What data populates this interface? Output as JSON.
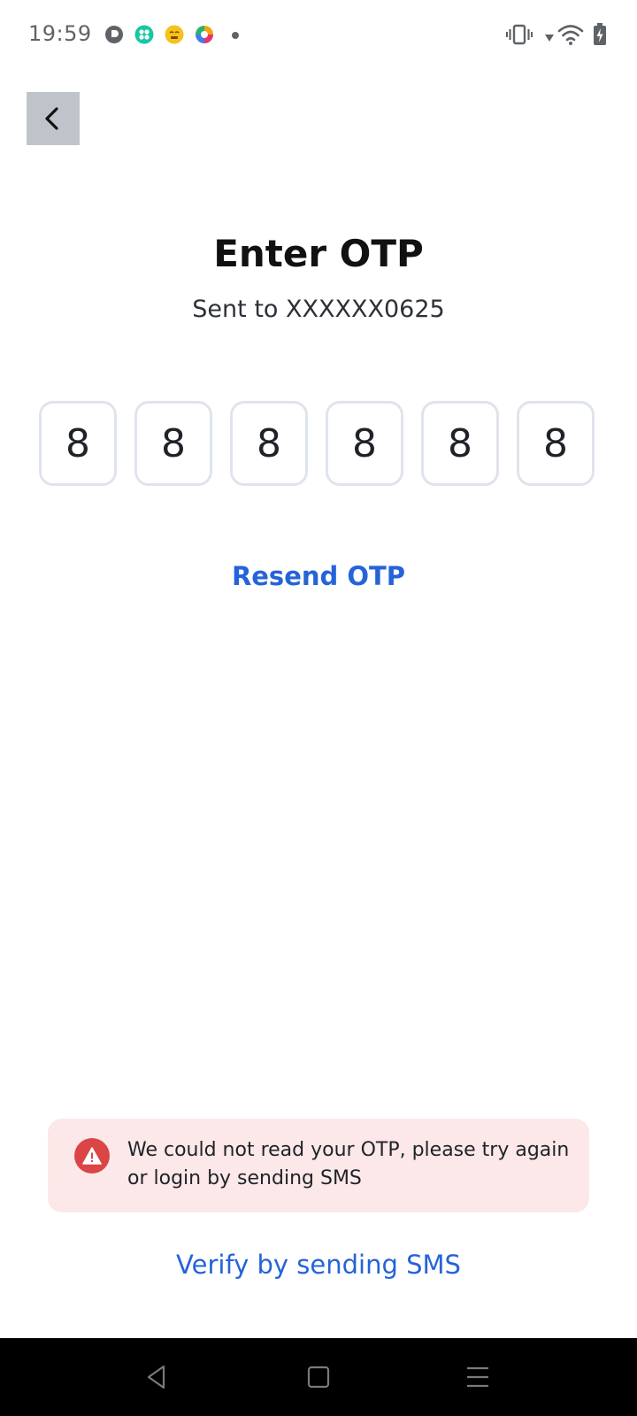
{
  "status_bar": {
    "time": "19:59",
    "notification_icons": [
      "podcast-app-icon",
      "grid-app-icon",
      "emoji-app-icon",
      "photos-app-icon",
      "more-dot-icon"
    ],
    "system_icons": [
      "vibrate-icon",
      "signal-arrow-icon",
      "wifi-icon",
      "battery-charging-icon"
    ]
  },
  "back_button": {
    "icon": "chevron-left-icon"
  },
  "title": "Enter OTP",
  "subtitle": "Sent to XXXXXX0625",
  "otp": {
    "digits": [
      "8",
      "8",
      "8",
      "8",
      "8",
      "8"
    ]
  },
  "resend_label": "Resend OTP",
  "error": {
    "icon": "warning-icon",
    "message": "We could not read your OTP, please try again or login by sending SMS",
    "color": "#dc4545",
    "background": "#fce8e8"
  },
  "verify_sms_label": "Verify by sending SMS",
  "nav_bar": {
    "buttons": [
      "back-triangle-icon",
      "home-square-icon",
      "menu-lines-icon"
    ]
  },
  "colors": {
    "accent": "#2563d8",
    "otp_border": "#dfe4ec",
    "back_button_bg": "#bfc3ca"
  }
}
